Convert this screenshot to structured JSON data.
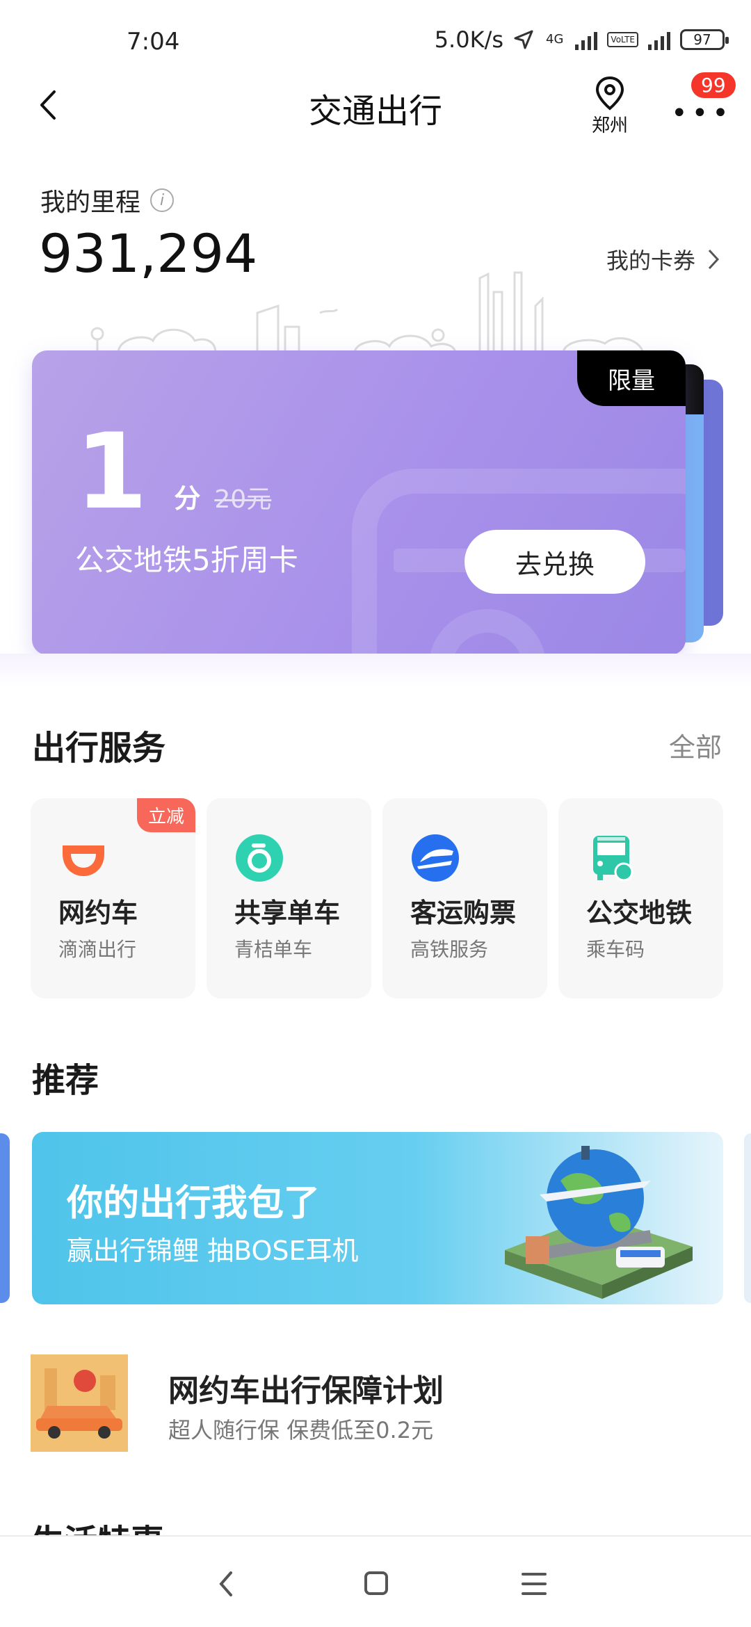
{
  "status_bar": {
    "time": "7:04",
    "speed": "5.0K/s",
    "net1": "4G",
    "volte": "VoLTE",
    "battery": "97"
  },
  "nav": {
    "title": "交通出行",
    "location": "郑州",
    "badge": "99"
  },
  "mileage": {
    "label": "我的里程",
    "value": "931,294",
    "cards_link": "我的卡券"
  },
  "promo": {
    "tag": "限量",
    "price": "1",
    "unit": "分",
    "original_price": "20元",
    "description": "公交地铁5折周卡",
    "button": "去兑换",
    "accent_color": "#a891ea"
  },
  "services": {
    "title": "出行服务",
    "more": "全部",
    "items": [
      {
        "title": "网约车",
        "subtitle": "滴滴出行",
        "tag": "立减",
        "icon": "didi-icon",
        "color": "#fb6a3a"
      },
      {
        "title": "共享单车",
        "subtitle": "青桔单车",
        "icon": "bike-icon",
        "color": "#2ed1b0"
      },
      {
        "title": "客运购票",
        "subtitle": "高铁服务",
        "icon": "train-icon",
        "color": "#2670ef"
      },
      {
        "title": "公交地铁",
        "subtitle": "乘车码",
        "icon": "bus-icon",
        "color": "#2ec8a8"
      }
    ]
  },
  "recommend": {
    "title": "推荐",
    "banner_title": "你的出行我包了",
    "banner_subtitle": "赢出行锦鲤 抽BOSE耳机"
  },
  "guarantee": {
    "title": "网约车出行保障计划",
    "subtitle": "超人随行保 保费低至0.2元"
  },
  "life": {
    "title": "生活特惠"
  }
}
